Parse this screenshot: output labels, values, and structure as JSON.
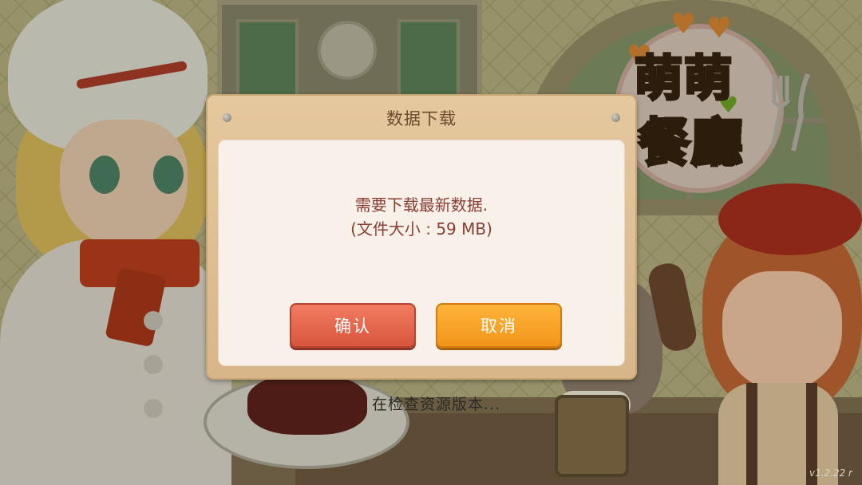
{
  "dialog": {
    "title": "数据下载",
    "message_line1": "需要下载最新数据.",
    "message_line2": "(文件大小 : 59 MB)",
    "confirm_label": "确认",
    "cancel_label": "取消"
  },
  "status": {
    "loading_text": "在检查资源版本...",
    "version": "v1.2.22 r"
  },
  "logo": {
    "line1": "萌萌",
    "line2": "餐廳"
  },
  "colors": {
    "dialog_frame": "#e6c89e",
    "dialog_body": "#f7f1ea",
    "confirm_button": "#e8664d",
    "cancel_button": "#f8a22a",
    "message_text": "#8a3d32",
    "title_text": "#6b4b2e"
  }
}
